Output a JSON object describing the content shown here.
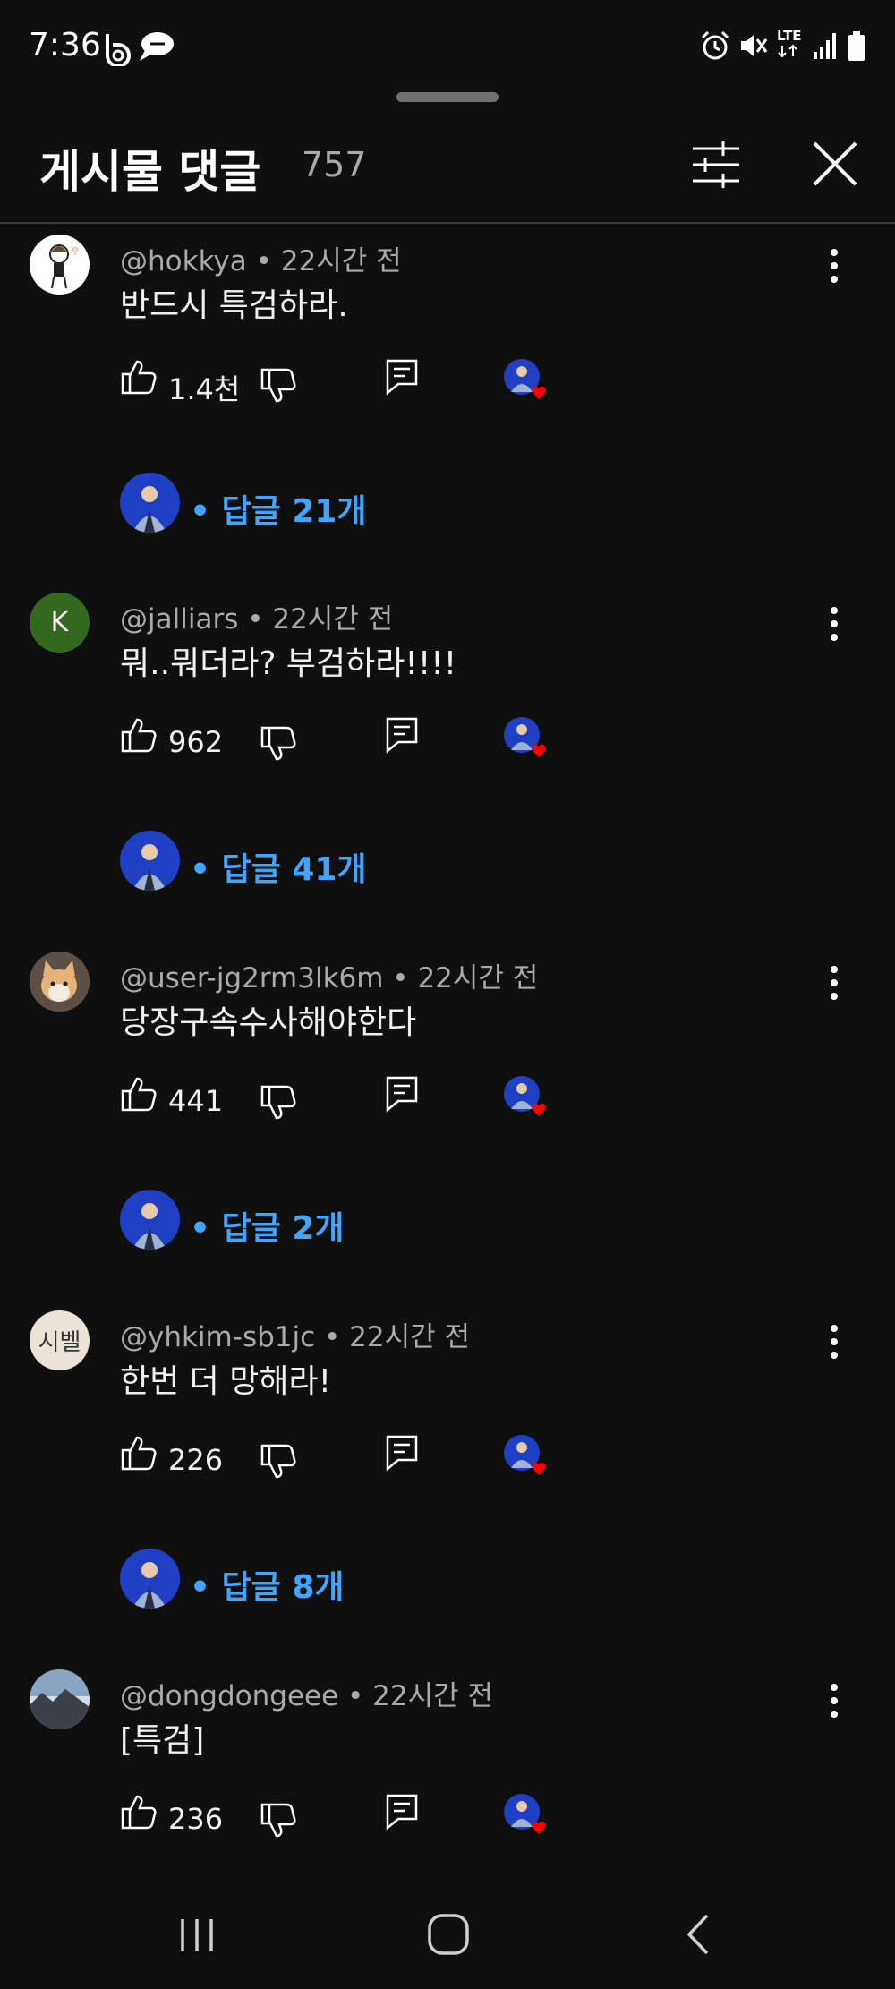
{
  "status_bar": {
    "time": "7:36",
    "network": "LTE",
    "icons": [
      "b-app-icon",
      "chat-bubble-icon",
      "alarm-icon",
      "vibrate-icon",
      "lte-icon",
      "signal-icon",
      "battery-icon"
    ]
  },
  "header": {
    "title": "게시물 댓글",
    "count": "757",
    "filter_icon": "filter-sliders-icon",
    "close_icon": "close-icon"
  },
  "comments": [
    {
      "author": "@hokkya",
      "time": "22시간 전",
      "text": "반드시 특검하라.",
      "likes": "1.4천",
      "replies": "• 답글 21개",
      "avatar": "drawing-avatar"
    },
    {
      "author": "@jalliars",
      "time": "22시간 전",
      "text": "뭐..뭐더라? 부검하라!!!!",
      "likes": "962",
      "replies": "• 답글 41개",
      "avatar": "letter-avatar",
      "avatar_letter": "K"
    },
    {
      "author": "@user-jg2rm3lk6m",
      "time": "22시간 전",
      "text": "당장구속수사해야한다",
      "likes": "441",
      "replies": "• 답글 2개",
      "avatar": "cat-photo-avatar"
    },
    {
      "author": "@yhkim-sb1jc",
      "time": "22시간 전",
      "text": "한번 더 망해라!",
      "likes": "226",
      "replies": "• 답글 8개",
      "avatar": "book-cover-avatar",
      "avatar_text": "시벨"
    },
    {
      "author": "@dongdongeee",
      "time": "22시간 전",
      "text": "[특검]",
      "likes": "236",
      "replies": "",
      "avatar": "landscape-photo-avatar"
    }
  ],
  "colors": {
    "background": "#0f0f0f",
    "reply_link": "#3ea6ff",
    "heart": "#ff0000",
    "secondary_text": "#aaaaaa"
  }
}
